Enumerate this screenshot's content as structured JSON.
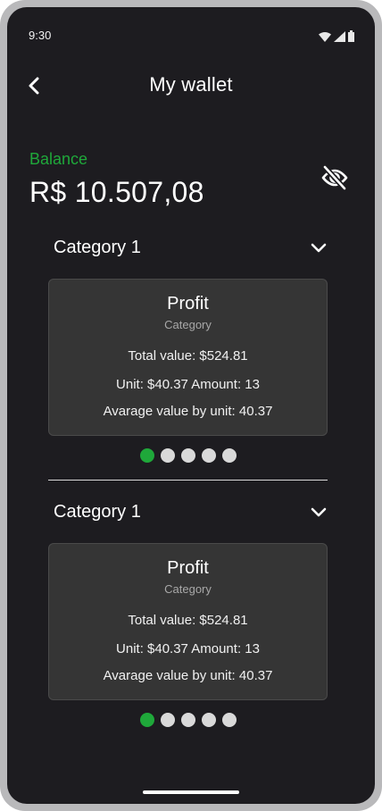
{
  "status_bar": {
    "time": "9:30"
  },
  "header": {
    "title": "My wallet",
    "back_icon": "chevron-left-icon"
  },
  "balance": {
    "label": "Balance",
    "value": "R$ 10.507,08",
    "label_color": "#1fa83a",
    "visibility_icon": "eye-off-icon"
  },
  "sections": [
    {
      "title": "Category 1",
      "card": {
        "title": "Profit",
        "subtitle": "Category",
        "total_value": "Total value: $524.81",
        "unit_amount": "Unit: $40.37 Amount: 13",
        "average": "Avarage value by unit: 40.37"
      },
      "pagination": {
        "total": 5,
        "active_index": 0
      }
    },
    {
      "title": "Category 1",
      "card": {
        "title": "Profit",
        "subtitle": "Category",
        "total_value": "Total value: $524.81",
        "unit_amount": "Unit: $40.37 Amount: 13",
        "average": "Avarage value by unit: 40.37"
      },
      "pagination": {
        "total": 5,
        "active_index": 0
      }
    }
  ],
  "colors": {
    "background": "#1d1c20",
    "card": "#353535",
    "accent": "#1fa83a",
    "inactive_dot": "#d9d9d9"
  }
}
